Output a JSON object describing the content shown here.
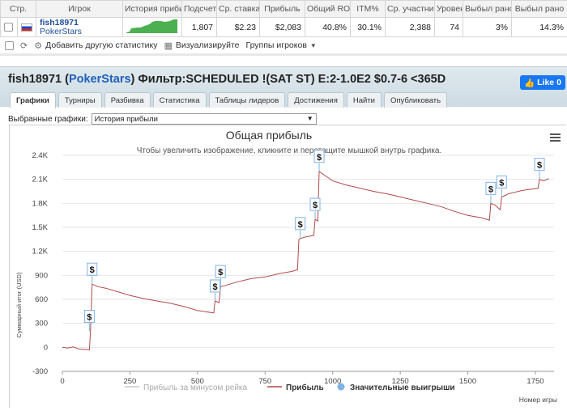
{
  "stats": {
    "headers": [
      "Стр.",
      "Игрок",
      "История прибыли",
      "Подсчет",
      "Ср. ставка",
      "Прибыль",
      "Общий ROI",
      "ITM%",
      "Ср. участник",
      "Уровень",
      "Выбыл рано",
      "Выбыл рано"
    ],
    "row": {
      "player_name": "fish18971",
      "site": "PokerStars",
      "count": "1,807",
      "avg_stake": "$2.23",
      "profit": "$2,083",
      "roi": "40.8%",
      "itm": "30.1%",
      "avg_entrants": "2,388",
      "level": "74",
      "early_exit_1": "3%",
      "early_exit_2": "14.3%"
    }
  },
  "toolbar": {
    "add_stats": "Добавить другую статистику",
    "visualize": "Визуализируйте",
    "player_groups": "Группы игроков"
  },
  "header": {
    "player": "fish18971",
    "site": "PokerStars",
    "filter": "Фильтр:SCHEDULED !(SAT ST) E:2-1.0E2 $0.7-6 <365D",
    "like": "Like 0"
  },
  "tabs": [
    "Графики",
    "Турниры",
    "Разбивка",
    "Статистика",
    "Таблицы лидеров",
    "Достижения",
    "Найти",
    "Опубликовать"
  ],
  "selector": {
    "label": "Выбранные графики:",
    "value": "История прибыли"
  },
  "colors": {
    "profit_line": "#b04a4a",
    "rake_line": "#c8c8c8",
    "big_win": "#7fb2e5",
    "accent": "#1f5fb8",
    "like": "#1877f2"
  },
  "chart_data": {
    "type": "line",
    "title": "Общая прибыль",
    "subtitle": "Чтобы увеличить изображение, кликните и перетащите мышкой внутрь графика.",
    "ylabel": "Суммарный итог (USD)",
    "xlabel": "Номер игры",
    "ylim": [
      -300,
      2400
    ],
    "xlim": [
      0,
      1807
    ],
    "yticks": [
      -300,
      0,
      300,
      600,
      900,
      1200,
      1500,
      1800,
      2100,
      2400
    ],
    "ytick_labels": [
      "-300",
      "0",
      "300",
      "600",
      "900",
      "1.2K",
      "1.5K",
      "1.8K",
      "2.1K",
      "2.4K"
    ],
    "xticks": [
      0,
      250,
      500,
      750,
      1000,
      1250,
      1500,
      1750
    ],
    "legend": [
      "Прибыль за минусом рейка",
      "Прибыль",
      "Значительные выигрыши"
    ],
    "legend_position": "bottom",
    "series": [
      {
        "name": "Прибыль",
        "x": [
          0,
          20,
          40,
          60,
          80,
          100,
          104,
          110,
          130,
          160,
          200,
          250,
          300,
          350,
          400,
          450,
          500,
          560,
          565,
          580,
          585,
          600,
          650,
          700,
          750,
          800,
          850,
          870,
          875,
          880,
          900,
          930,
          935,
          945,
          950,
          1000,
          1050,
          1100,
          1150,
          1200,
          1250,
          1300,
          1350,
          1400,
          1450,
          1500,
          1550,
          1580,
          1585,
          1600,
          1620,
          1625,
          1640,
          1650,
          1700,
          1760,
          1765,
          1780,
          1800
        ],
        "y": [
          0,
          -10,
          5,
          -20,
          -25,
          -30,
          200,
          790,
          760,
          740,
          700,
          650,
          610,
          580,
          550,
          510,
          460,
          430,
          580,
          560,
          760,
          770,
          820,
          860,
          880,
          920,
          950,
          970,
          1350,
          1360,
          1380,
          1400,
          1600,
          1580,
          2200,
          2080,
          2030,
          1990,
          1950,
          1920,
          1880,
          1840,
          1800,
          1760,
          1700,
          1650,
          1620,
          1590,
          1800,
          1780,
          1720,
          1880,
          1900,
          1920,
          1960,
          1990,
          2100,
          2080,
          2110
        ]
      }
    ],
    "big_wins": [
      {
        "x": 100,
        "y": 200,
        "label": "$"
      },
      {
        "x": 110,
        "y": 790,
        "label": "$"
      },
      {
        "x": 565,
        "y": 580,
        "label": "$"
      },
      {
        "x": 585,
        "y": 760,
        "label": "$"
      },
      {
        "x": 880,
        "y": 1360,
        "label": "$"
      },
      {
        "x": 935,
        "y": 1600,
        "label": "$"
      },
      {
        "x": 950,
        "y": 2200,
        "label": "$"
      },
      {
        "x": 1585,
        "y": 1800,
        "label": "$"
      },
      {
        "x": 1625,
        "y": 1880,
        "label": "$"
      },
      {
        "x": 1765,
        "y": 2100,
        "label": "$"
      }
    ]
  }
}
